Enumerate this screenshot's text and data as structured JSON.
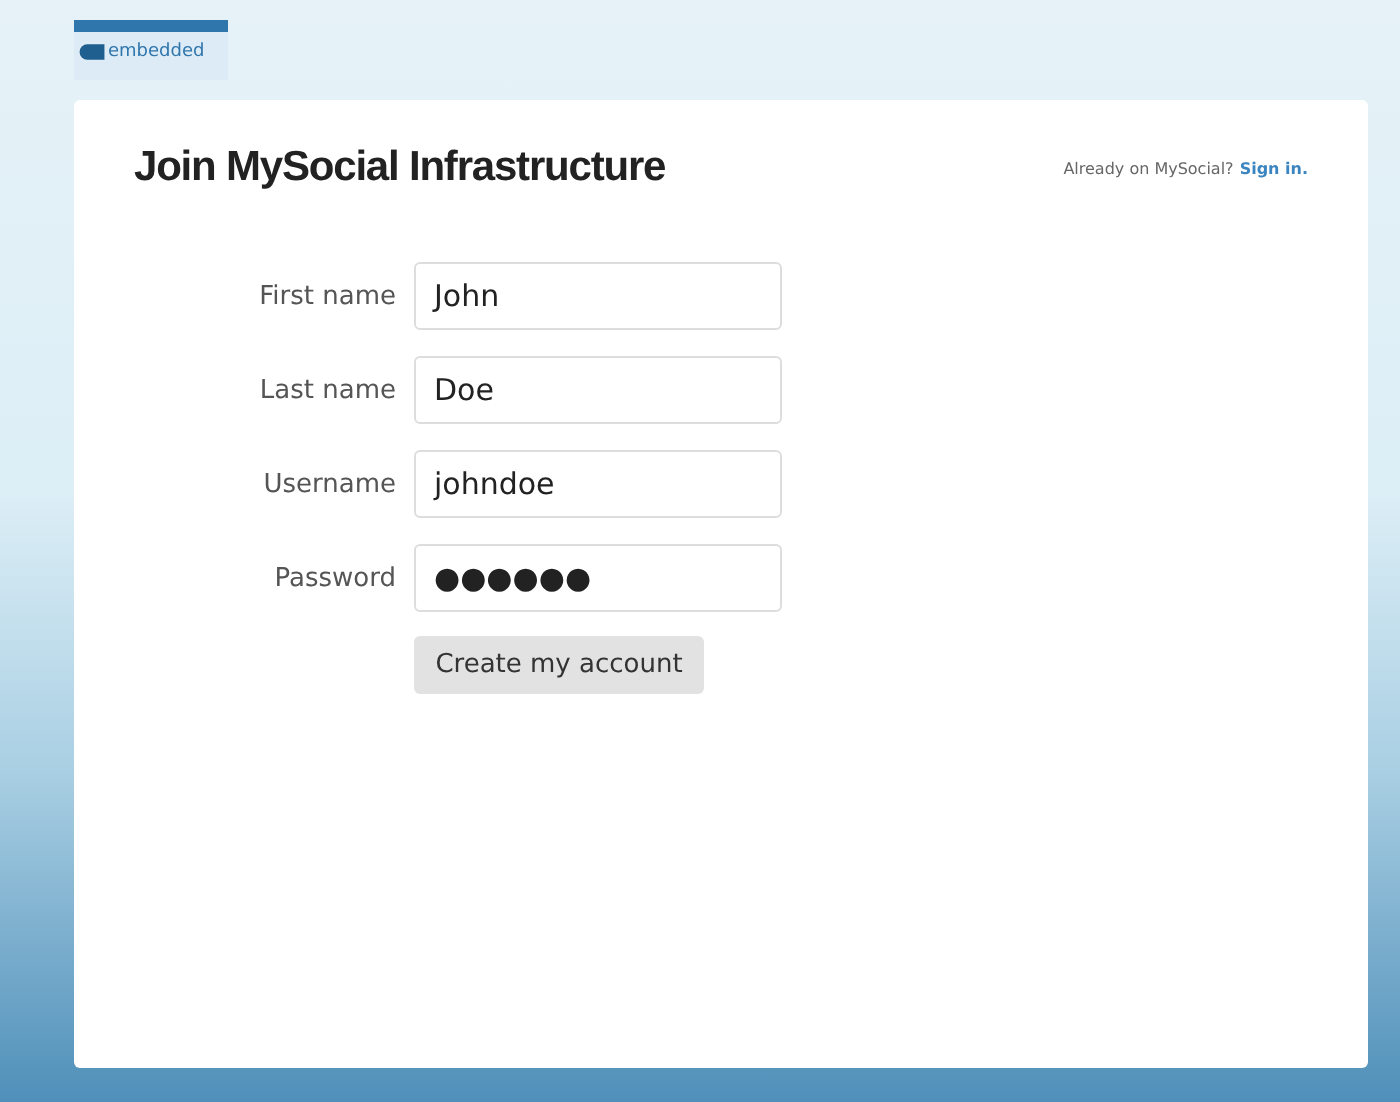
{
  "logo": {
    "text": "embedded"
  },
  "title": "Join MySocial Infrastructure",
  "signin": {
    "prompt": "Already on MySocial?",
    "link": "Sign in."
  },
  "fields": [
    {
      "label": "First name",
      "value": "John"
    },
    {
      "label": "Last name",
      "value": "Doe"
    },
    {
      "label": "Username",
      "value": "johndoe"
    },
    {
      "label": "Password",
      "value": "●●●●●●"
    }
  ],
  "button": "Create my account"
}
